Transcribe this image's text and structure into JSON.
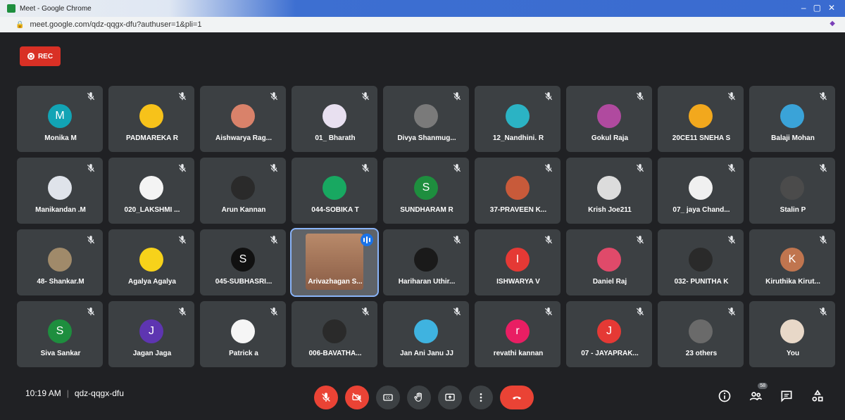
{
  "window": {
    "title": "Meet - Google Chrome",
    "url": "meet.google.com/qdz-qqgx-dfu?authuser=1&pli=1"
  },
  "rec_label": "REC",
  "participants": [
    {
      "name": "Monika M",
      "initial": "M",
      "color": "#12a4b5"
    },
    {
      "name": "PADMAREKA R",
      "initial": "",
      "color": "#f7c21a"
    },
    {
      "name": "Aishwarya Rag...",
      "initial": "",
      "color": "#d9826a"
    },
    {
      "name": "01_ Bharath",
      "initial": "",
      "color": "#e8e0f0"
    },
    {
      "name": "Divya Shanmug...",
      "initial": "",
      "color": "#7a7a7a"
    },
    {
      "name": "12_Nandhini. R",
      "initial": "",
      "color": "#2bb3c4"
    },
    {
      "name": "Gokul Raja",
      "initial": "",
      "color": "#b04a9f"
    },
    {
      "name": "20CE11 SNEHA S",
      "initial": "",
      "color": "#f2a81d"
    },
    {
      "name": "Balaji Mohan",
      "initial": "",
      "color": "#3aa3d8"
    },
    {
      "name": "Manikandan .M",
      "initial": "",
      "color": "#dfe3ea"
    },
    {
      "name": "020_LAKSHMI ...",
      "initial": "",
      "color": "#f4f4f4"
    },
    {
      "name": "Arun Kannan",
      "initial": "",
      "color": "#2a2a2a"
    },
    {
      "name": "044-SOBIKA T",
      "initial": "",
      "color": "#18a861"
    },
    {
      "name": "SUNDHARAM R",
      "initial": "S",
      "color": "#1e8e3e"
    },
    {
      "name": "37-PRAVEEN K...",
      "initial": "",
      "color": "#c85a3a"
    },
    {
      "name": "Krish Joe211",
      "initial": "",
      "color": "#dcdcdc"
    },
    {
      "name": "07_ jaya Chand...",
      "initial": "",
      "color": "#f0f0f0"
    },
    {
      "name": "Stalin P",
      "initial": "",
      "color": "#4b4b4b"
    },
    {
      "name": "48- Shankar.M",
      "initial": "",
      "color": "#a08a6a"
    },
    {
      "name": "Agalya Agalya",
      "initial": "",
      "color": "#f7d21a"
    },
    {
      "name": "045-SUBHASRI...",
      "initial": "S",
      "color": "#111111"
    },
    {
      "name": "Arivazhagan S...",
      "initial": "",
      "color": "#b98a6a",
      "active": true
    },
    {
      "name": "Hariharan Uthir...",
      "initial": "",
      "color": "#1a1a1a"
    },
    {
      "name": "ISHWARYA V",
      "initial": "I",
      "color": "#e53935"
    },
    {
      "name": "Daniel Raj",
      "initial": "",
      "color": "#e04a6a"
    },
    {
      "name": "032- PUNITHA K",
      "initial": "",
      "color": "#2a2a2a"
    },
    {
      "name": "Kiruthika Kirut...",
      "initial": "K",
      "color": "#c0754f"
    },
    {
      "name": "Siva Sankar",
      "initial": "S",
      "color": "#1e8e3e"
    },
    {
      "name": "Jagan Jaga",
      "initial": "J",
      "color": "#5e35b1"
    },
    {
      "name": "Patrick a",
      "initial": "",
      "color": "#f5f5f5"
    },
    {
      "name": "006-BAVATHA...",
      "initial": "",
      "color": "#2a2a2a"
    },
    {
      "name": "Jan Ani Janu JJ",
      "initial": "",
      "color": "#3fb3e0"
    },
    {
      "name": "revathi kannan",
      "initial": "r",
      "color": "#e91e63"
    },
    {
      "name": "07 - JAYAPRAK...",
      "initial": "J",
      "color": "#e53935"
    },
    {
      "name": "23 others",
      "initial": "",
      "color": "#6a6a6a"
    },
    {
      "name": "You",
      "initial": "",
      "color": "#e8d8c8"
    }
  ],
  "meeting": {
    "time": "10:19 AM",
    "code": "qdz-qqgx-dfu"
  },
  "controls": [
    "mic-off",
    "camera-off",
    "captions",
    "raise-hand",
    "present",
    "more",
    "end-call"
  ],
  "people_count": "58",
  "colors": {
    "bg": "#202124",
    "tile": "#3c4043",
    "red": "#ea4335",
    "blue": "#1a73e8"
  }
}
